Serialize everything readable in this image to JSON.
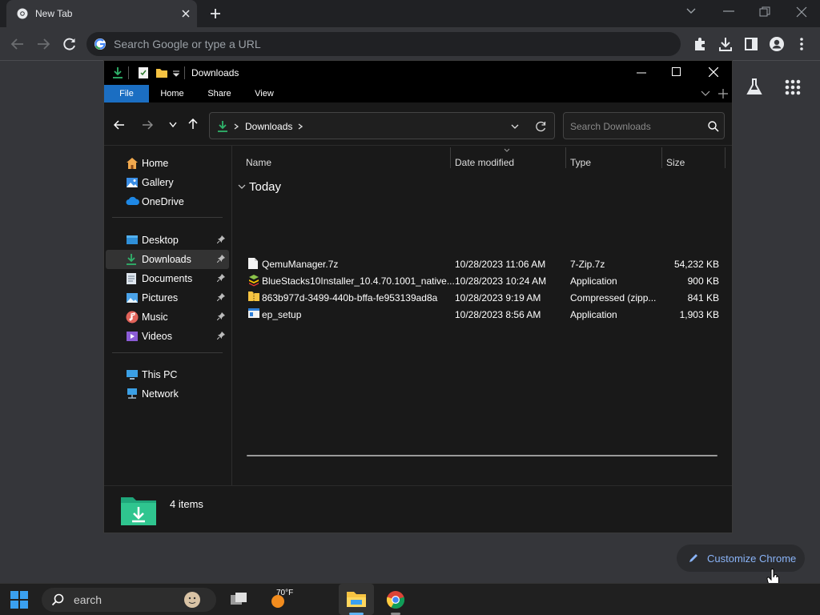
{
  "chrome": {
    "tab_title": "New Tab",
    "omnibox_placeholder": "Search Google or type a URL",
    "customize_label": "Customize Chrome"
  },
  "explorer": {
    "title": "Downloads",
    "ribbon_tabs": [
      "File",
      "Home",
      "Share",
      "View"
    ],
    "address": "Downloads",
    "search_placeholder": "Search Downloads",
    "nav": {
      "group1": [
        "Home",
        "Gallery",
        "OneDrive"
      ],
      "group2": [
        "Desktop",
        "Downloads",
        "Documents",
        "Pictures",
        "Music",
        "Videos"
      ],
      "group3": [
        "This PC",
        "Network"
      ],
      "active": "Downloads"
    },
    "columns": [
      "Name",
      "Date modified",
      "Type",
      "Size"
    ],
    "group_header": "Today",
    "files": [
      {
        "name": "QemuManager.7z",
        "date": "10/28/2023 11:06 AM",
        "type": "7-Zip.7z",
        "size": "54,232 KB",
        "icon": "7z-file-icon"
      },
      {
        "name": "BlueStacks10Installer_10.4.70.1001_native...",
        "date": "10/28/2023 10:24 AM",
        "type": "Application",
        "size": "900 KB",
        "icon": "bluestacks-icon"
      },
      {
        "name": "863b977d-3499-440b-bffa-fe953139ad8a",
        "date": "10/28/2023 9:19 AM",
        "type": "Compressed (zipp...",
        "size": "841 KB",
        "icon": "zip-folder-icon"
      },
      {
        "name": "ep_setup",
        "date": "10/28/2023 8:56 AM",
        "type": "Application",
        "size": "1,903 KB",
        "icon": "app-icon"
      }
    ],
    "status": "4 items"
  },
  "taskbar": {
    "search_text": "earch",
    "weather": "70°F"
  },
  "colors": {
    "accent_blue": "#1b6ec2",
    "link_blue": "#8ab4f8",
    "downloads_green": "#2fb36b"
  }
}
